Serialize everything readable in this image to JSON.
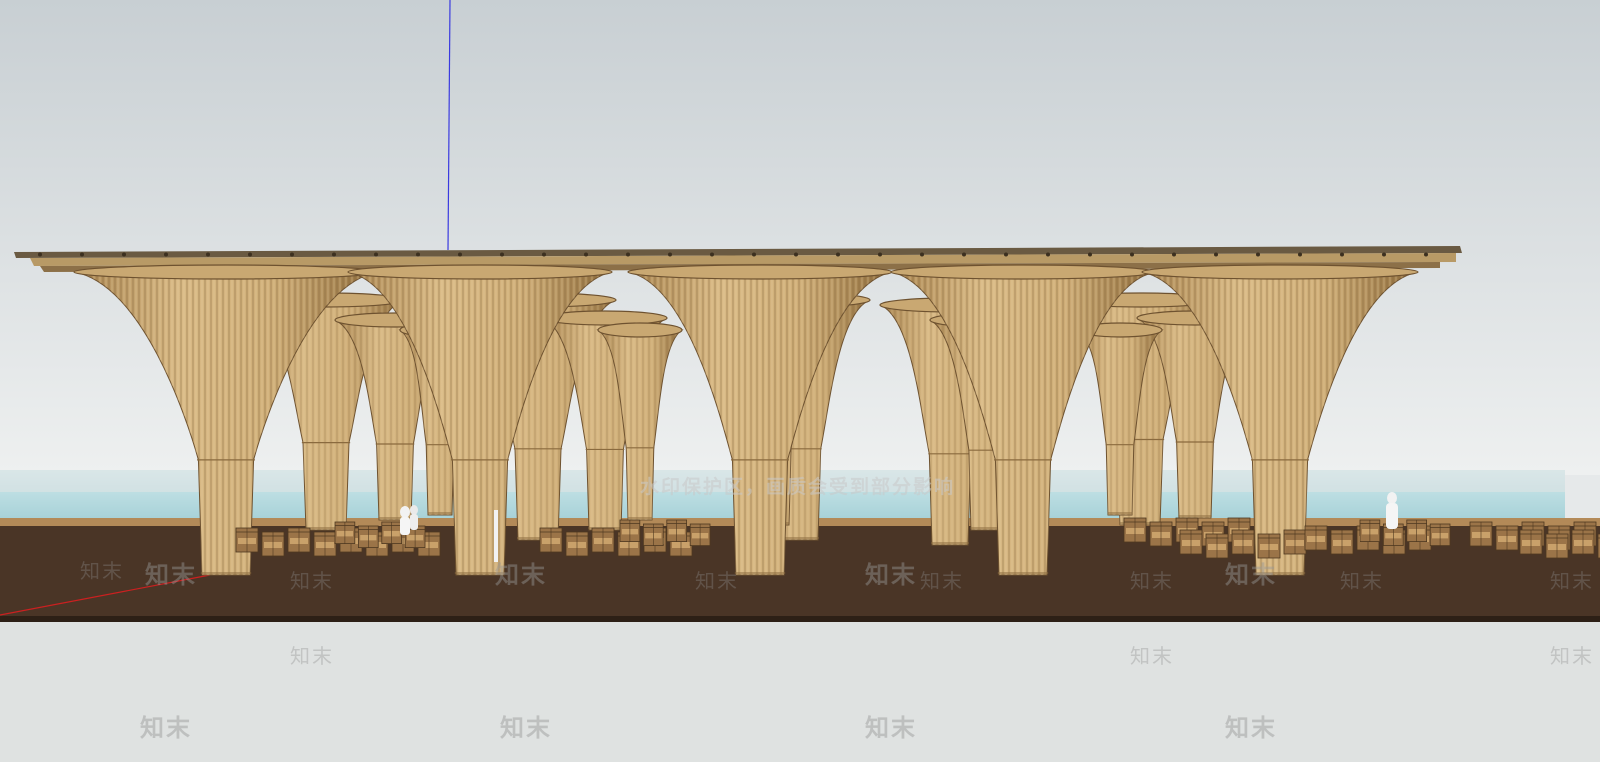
{
  "viewport": {
    "name": "SketchUp 3D model viewport",
    "content": "bamboo canopy pavilion with seating"
  },
  "colors": {
    "sky_top": "#c9d0d4",
    "sky_bottom": "#eceeef",
    "ground": "#e0e3e2",
    "floor_dark": "#4a3526",
    "floor_edge": "#3a2a1e",
    "water": "#b9dde2",
    "bamboo_light": "#d8b884",
    "bamboo_mid": "#b8925a",
    "bamboo_dark": "#7d5e34",
    "roof_edge": "#5a4a35",
    "blue_axis": "#3a3ae0",
    "red_axis": "#cc2020"
  },
  "watermark": {
    "banner": "水印保护区，画质会受到部分影响",
    "logo_text": "知末"
  }
}
